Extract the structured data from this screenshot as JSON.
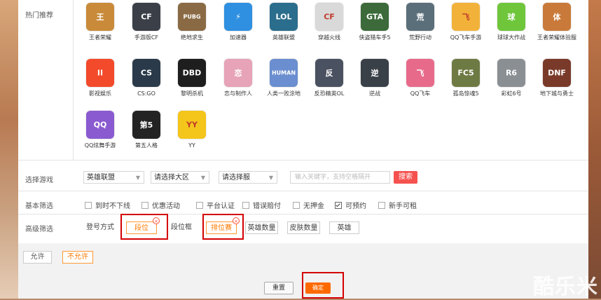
{
  "sections": {
    "hot": "热门推荐",
    "select_game": "选择游戏",
    "basic_filter": "基本筛选",
    "advanced_filter": "高级筛选"
  },
  "games": [
    {
      "name": "王者荣耀",
      "color": "#c98b3a",
      "glyph": "王"
    },
    {
      "name": "手游版CF",
      "color": "#3a3f48",
      "glyph": "CF"
    },
    {
      "name": "绝地求生",
      "color": "#8a6a44",
      "glyph": "PUBG"
    },
    {
      "name": "加速器",
      "color": "#2f8fe0",
      "glyph": "⚡"
    },
    {
      "name": "英雄联盟",
      "color": "#2a6d8c",
      "glyph": "LOL"
    },
    {
      "name": "穿越火线",
      "color": "#d9d9d9",
      "glyph": "CF"
    },
    {
      "name": "侠盗猎车手5",
      "color": "#3c6a3a",
      "glyph": "GTA"
    },
    {
      "name": "荒野行动",
      "color": "#5b6f7a",
      "glyph": "荒"
    },
    {
      "name": "QQ飞车手游",
      "color": "#f2b23a",
      "glyph": "飞"
    },
    {
      "name": "球球大作战",
      "color": "#6fc63b",
      "glyph": "球"
    },
    {
      "name": "王者荣耀体验服",
      "color": "#c97a3a",
      "glyph": "体"
    },
    {
      "name": "影视娱乐",
      "color": "#f24a2a",
      "glyph": "II"
    },
    {
      "name": "CS:GO",
      "color": "#2a3a4a",
      "glyph": "CS"
    },
    {
      "name": "黎明杀机",
      "color": "#1e1e1e",
      "glyph": "DBD"
    },
    {
      "name": "恋与制作人",
      "color": "#e7a3b7",
      "glyph": "恋"
    },
    {
      "name": "人类一败涂地",
      "color": "#6a8ecf",
      "glyph": "HUMAN"
    },
    {
      "name": "反恐精英OL",
      "color": "#4a5160",
      "glyph": "反"
    },
    {
      "name": "逆战",
      "color": "#3a4048",
      "glyph": "逆"
    },
    {
      "name": "QQ飞车",
      "color": "#e86a8a",
      "glyph": "飞"
    },
    {
      "name": "孤岛惊魂5",
      "color": "#6e7a44",
      "glyph": "FC5"
    },
    {
      "name": "彩虹6号",
      "color": "#8a8f94",
      "glyph": "R6"
    },
    {
      "name": "地下城与勇士",
      "color": "#7a3a2a",
      "glyph": "DNF"
    },
    {
      "name": "QQ炫舞手游",
      "color": "#8a5ad0",
      "glyph": "QQ"
    },
    {
      "name": "第五人格",
      "color": "#232323",
      "glyph": "第5"
    },
    {
      "name": "YY",
      "color": "#f4c51a",
      "glyph": "YY"
    }
  ],
  "selects": {
    "game": "英雄联盟",
    "region": "请选择大区",
    "server": "请选择服"
  },
  "search": {
    "placeholder": "输入关键字，支持空格隔开",
    "button": "搜索"
  },
  "basic_options": [
    {
      "label": "到时不下线",
      "checked": false
    },
    {
      "label": "优惠活动",
      "checked": false
    },
    {
      "label": "平台认证",
      "checked": false
    },
    {
      "label": "错误赔付",
      "checked": false
    },
    {
      "label": "无押金",
      "checked": false
    },
    {
      "label": "可预约",
      "checked": true
    },
    {
      "label": "新手可租",
      "checked": false
    }
  ],
  "advanced_tags": [
    {
      "label": "登号方式",
      "bordered": false
    },
    {
      "label": "段位",
      "active": true
    },
    {
      "label": "段位框",
      "bordered": false
    },
    {
      "label": "排位赛",
      "active": true
    },
    {
      "label": "英雄数量"
    },
    {
      "label": "皮肤数量"
    },
    {
      "label": "英雄"
    }
  ],
  "remove_glyph": "×",
  "footer": {
    "allow": "允许",
    "disallow": "不允许",
    "reset": "重置",
    "confirm": "确定"
  },
  "watermark": "酷乐米",
  "colors": {
    "accent": "#ff7a00",
    "search": "#f5524f",
    "highlight": "#d40000"
  }
}
